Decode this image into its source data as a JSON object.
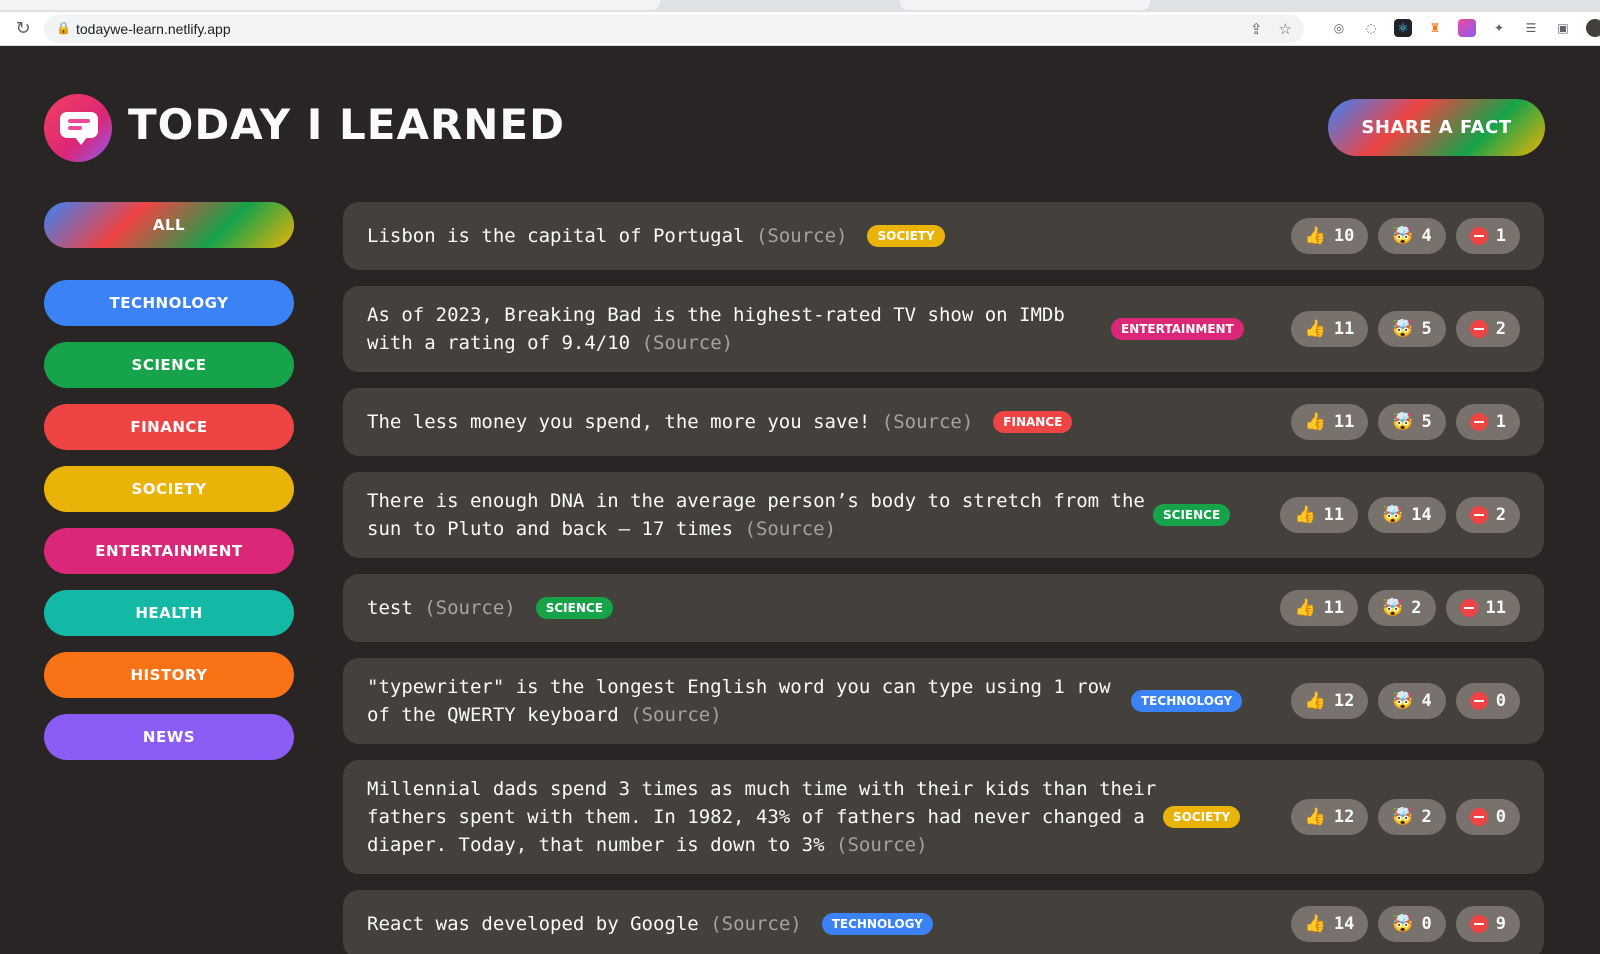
{
  "browser": {
    "url": "todaywe-learn.netlify.app",
    "reload_icon": "reload-icon",
    "lock_icon": "lock-icon"
  },
  "header": {
    "title": "Today I Learned",
    "share_label": "Share a fact"
  },
  "categories": {
    "all_label": "All",
    "items": [
      {
        "label": "Technology",
        "color": "#3b82f6"
      },
      {
        "label": "Science",
        "color": "#16a34a"
      },
      {
        "label": "Finance",
        "color": "#ef4444"
      },
      {
        "label": "Society",
        "color": "#eab308"
      },
      {
        "label": "Entertainment",
        "color": "#db2777"
      },
      {
        "label": "Health",
        "color": "#14b8a6"
      },
      {
        "label": "History",
        "color": "#f97316"
      },
      {
        "label": "News",
        "color": "#8b5cf6"
      }
    ]
  },
  "facts": [
    {
      "text": "Lisbon is the capital of Portugal",
      "source": "(Source)",
      "category": "Society",
      "category_color": "#eab308",
      "likes": "10",
      "mindblowing": "4",
      "false": "1"
    },
    {
      "text": "As of 2023, Breaking Bad is the highest-rated TV show on IMDb with a rating of 9.4/10",
      "source": "(Source)",
      "category": "Entertainment",
      "category_color": "#db2777",
      "likes": "11",
      "mindblowing": "5",
      "false": "2"
    },
    {
      "text": "The less money you spend, the more you save!",
      "source": "(Source)",
      "category": "Finance",
      "category_color": "#ef4444",
      "likes": "11",
      "mindblowing": "5",
      "false": "1"
    },
    {
      "text": "There is enough DNA in the average person’s body to stretch from the sun to Pluto and back — 17 times",
      "source": "(Source)",
      "category": "Science",
      "category_color": "#16a34a",
      "likes": "11",
      "mindblowing": "14",
      "false": "2"
    },
    {
      "text": "test",
      "source": "(Source)",
      "category": "Science",
      "category_color": "#16a34a",
      "likes": "11",
      "mindblowing": "2",
      "false": "11"
    },
    {
      "text": "\"typewriter\" is the longest English word you can type using 1 row of the QWERTY keyboard",
      "source": "(Source)",
      "category": "Technology",
      "category_color": "#3b82f6",
      "likes": "12",
      "mindblowing": "4",
      "false": "0"
    },
    {
      "text": "Millennial dads spend 3 times as much time with their kids than their fathers spent with them. In 1982, 43% of fathers had never changed a diaper. Today, that number is down to 3%",
      "source": "(Source)",
      "category": "Society",
      "category_color": "#eab308",
      "likes": "12",
      "mindblowing": "2",
      "false": "0"
    },
    {
      "text": "React was developed by Google",
      "source": "(Source)",
      "category": "Technology",
      "category_color": "#3b82f6",
      "likes": "14",
      "mindblowing": "0",
      "false": "9"
    }
  ],
  "vote_icons": {
    "like": "👍",
    "mindblowing": "🤯"
  }
}
